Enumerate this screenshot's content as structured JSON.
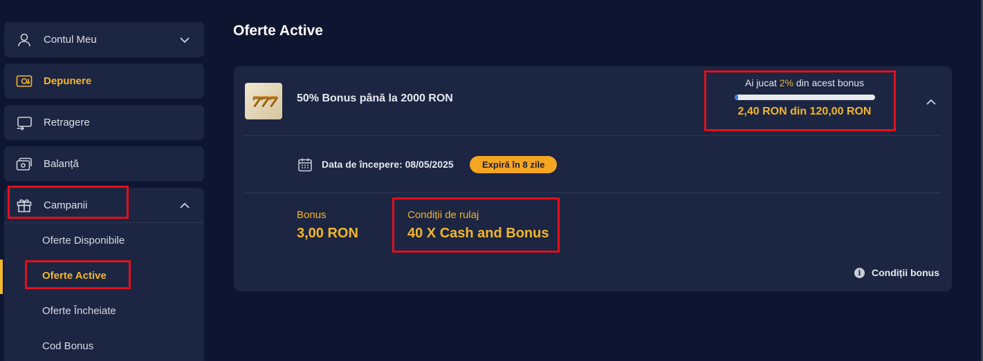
{
  "sidebar": {
    "items": [
      {
        "label": "Contul Meu",
        "icon": "user-icon"
      },
      {
        "label": "Depunere",
        "icon": "deposit-icon"
      },
      {
        "label": "Retragere",
        "icon": "withdraw-icon"
      },
      {
        "label": "Balanță",
        "icon": "wallet-icon"
      }
    ],
    "campaign": {
      "label": "Campanii",
      "icon": "gift-icon",
      "sub_items": [
        {
          "label": "Oferte Disponibile"
        },
        {
          "label": "Oferte Active"
        },
        {
          "label": "Oferte Încheiate"
        },
        {
          "label": "Cod Bonus"
        }
      ]
    }
  },
  "main": {
    "title": "Oferte Active",
    "offer": {
      "title": "50% Bonus până la 2000 RON",
      "thumb_text": "777",
      "progress_prefix": "Ai jucat ",
      "progress_pct": "2%",
      "progress_suffix": " din acest bonus",
      "progress_fraction": 0.02,
      "progress_amount": "2,40 RON din 120,00 RON",
      "start_date": "Data de începere: 08/05/2025",
      "expire_badge": "Expiră în 8 zile",
      "bonus_label": "Bonus",
      "bonus_value": "3,00 RON",
      "wager_label": "Condiții de rulaj",
      "wager_value": "40 X Cash and Bonus",
      "conditions_link": "Condiții bonus"
    }
  },
  "colors": {
    "background": "#0e1530",
    "panel": "#1c2541",
    "accent": "#f4b72a",
    "highlight_box": "#e3101c"
  }
}
